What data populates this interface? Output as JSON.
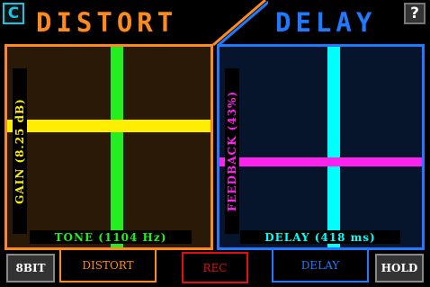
{
  "header": {
    "c_label": "C",
    "help_label": "?",
    "distort_title": "DISTORT",
    "delay_title": "DELAY"
  },
  "distort_panel": {
    "gain_label": "GAIN (8.25 dB)",
    "tone_label": "TONE (1104 Hz)",
    "colors": {
      "border": "#ff8a1c",
      "gain_line": "#ffee00",
      "tone_line": "#22ee22"
    }
  },
  "delay_panel": {
    "feedback_label": "FEEDBACK (43%)",
    "delay_label": "DELAY (418 ms)",
    "colors": {
      "border": "#1e7bff",
      "feedback_line": "#ff22ee",
      "delay_line": "#00ffff"
    }
  },
  "bottom_bar": {
    "bit_label": "8BIT",
    "distort_label": "DISTORT",
    "rec_label": "REC",
    "delay_label": "DELAY",
    "hold_label": "HOLD"
  },
  "colors": {
    "distort_accent": "#ff8a1c",
    "delay_accent": "#1e7bff",
    "rec": "#e01010"
  }
}
